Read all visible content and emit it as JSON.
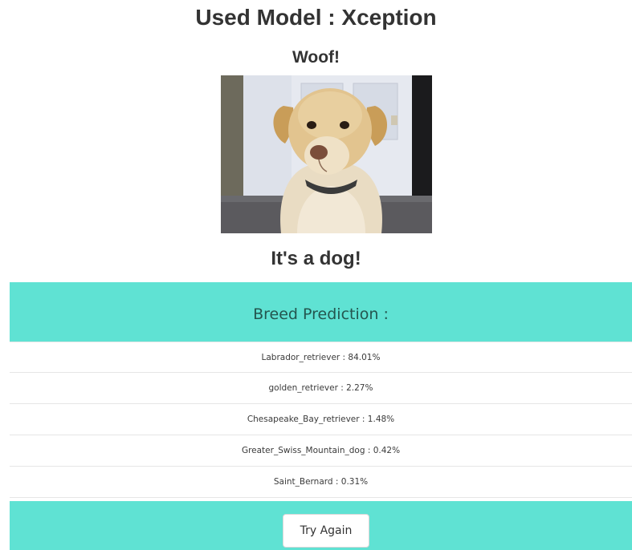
{
  "header": {
    "model_title": "Used Model : Xception",
    "greeting": "Woof!"
  },
  "image": {
    "subject": "dog-photo"
  },
  "result": {
    "verdict": "It's a dog!"
  },
  "breed_panel": {
    "header_label": "Breed Prediction :",
    "predictions": [
      {
        "text": "Labrador_retriever : 84.01%"
      },
      {
        "text": "golden_retriever : 2.27%"
      },
      {
        "text": "Chesapeake_Bay_retriever : 1.48%"
      },
      {
        "text": "Greater_Swiss_Mountain_dog : 0.42%"
      },
      {
        "text": "Saint_Bernard : 0.31%"
      }
    ]
  },
  "actions": {
    "try_again_label": "Try Again"
  },
  "colors": {
    "accent": "#5fe2d3",
    "header_text": "#24564f"
  }
}
